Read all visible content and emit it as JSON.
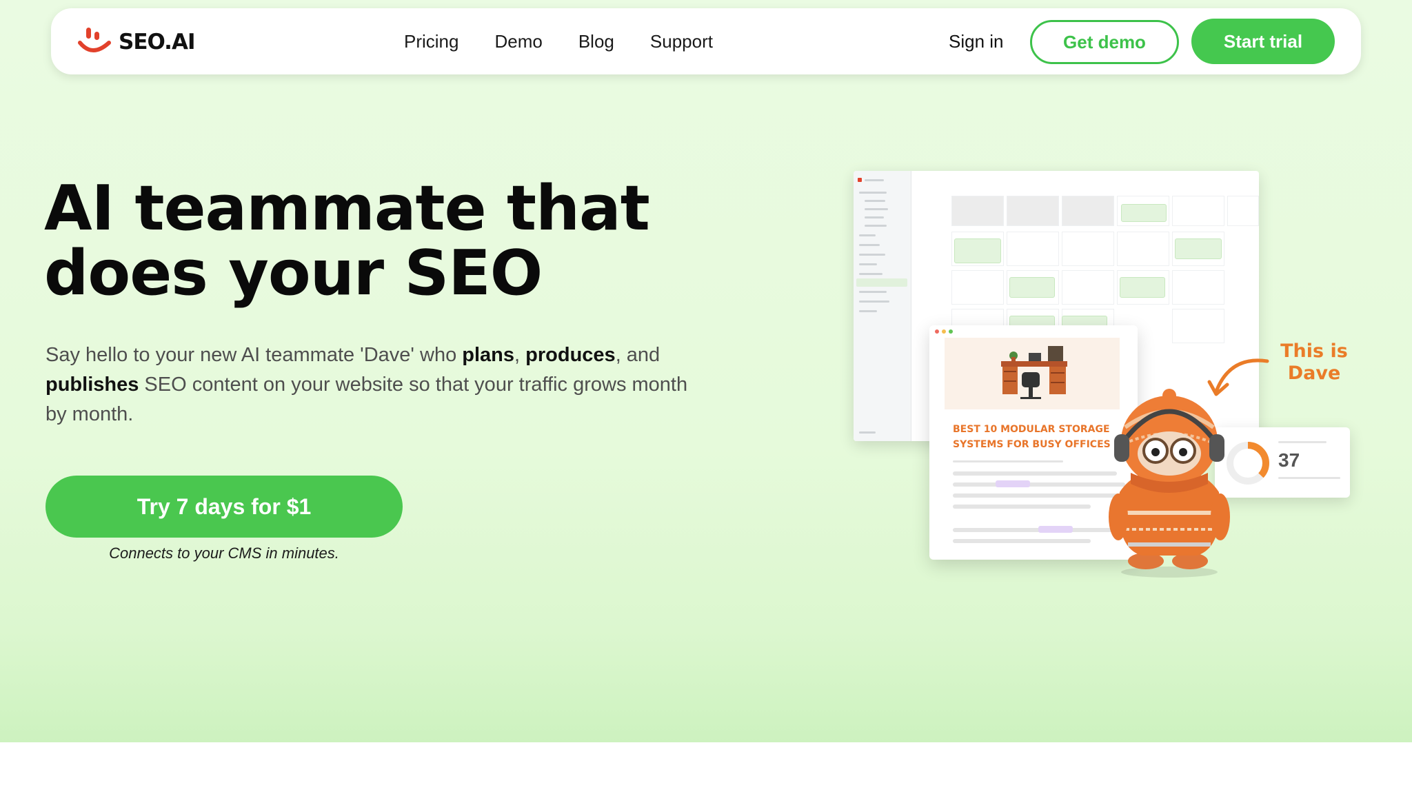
{
  "brand": {
    "name": "SEO.AI",
    "green": "#45c84f",
    "orange": "#ea7c28"
  },
  "nav": {
    "links": [
      "Pricing",
      "Demo",
      "Blog",
      "Support"
    ],
    "signin_label": "Sign in",
    "demo_label": "Get demo",
    "trial_label": "Start trial"
  },
  "hero": {
    "headline_line1": "AI teammate that",
    "headline_line2": "does your SEO",
    "sub_part1": "Say hello to your new AI teammate 'Dave' who ",
    "sub_plans": "plans",
    "sub_comma": ", ",
    "sub_produces": "produces",
    "sub_and": ", and ",
    "sub_publishes": "publishes",
    "sub_part2": " SEO content on your website so that your traffic grows month by month.",
    "cta_label": "Try 7 days for $1",
    "cta_note": "Connects to your CMS in minutes."
  },
  "illustration": {
    "article_title": "BEST 10 MODULAR STORAGE SYSTEMS FOR BUSY OFFICES",
    "score_value": "37",
    "score_level": 0.37,
    "dave_label_line1": "This is",
    "dave_label_line2": "Dave"
  }
}
